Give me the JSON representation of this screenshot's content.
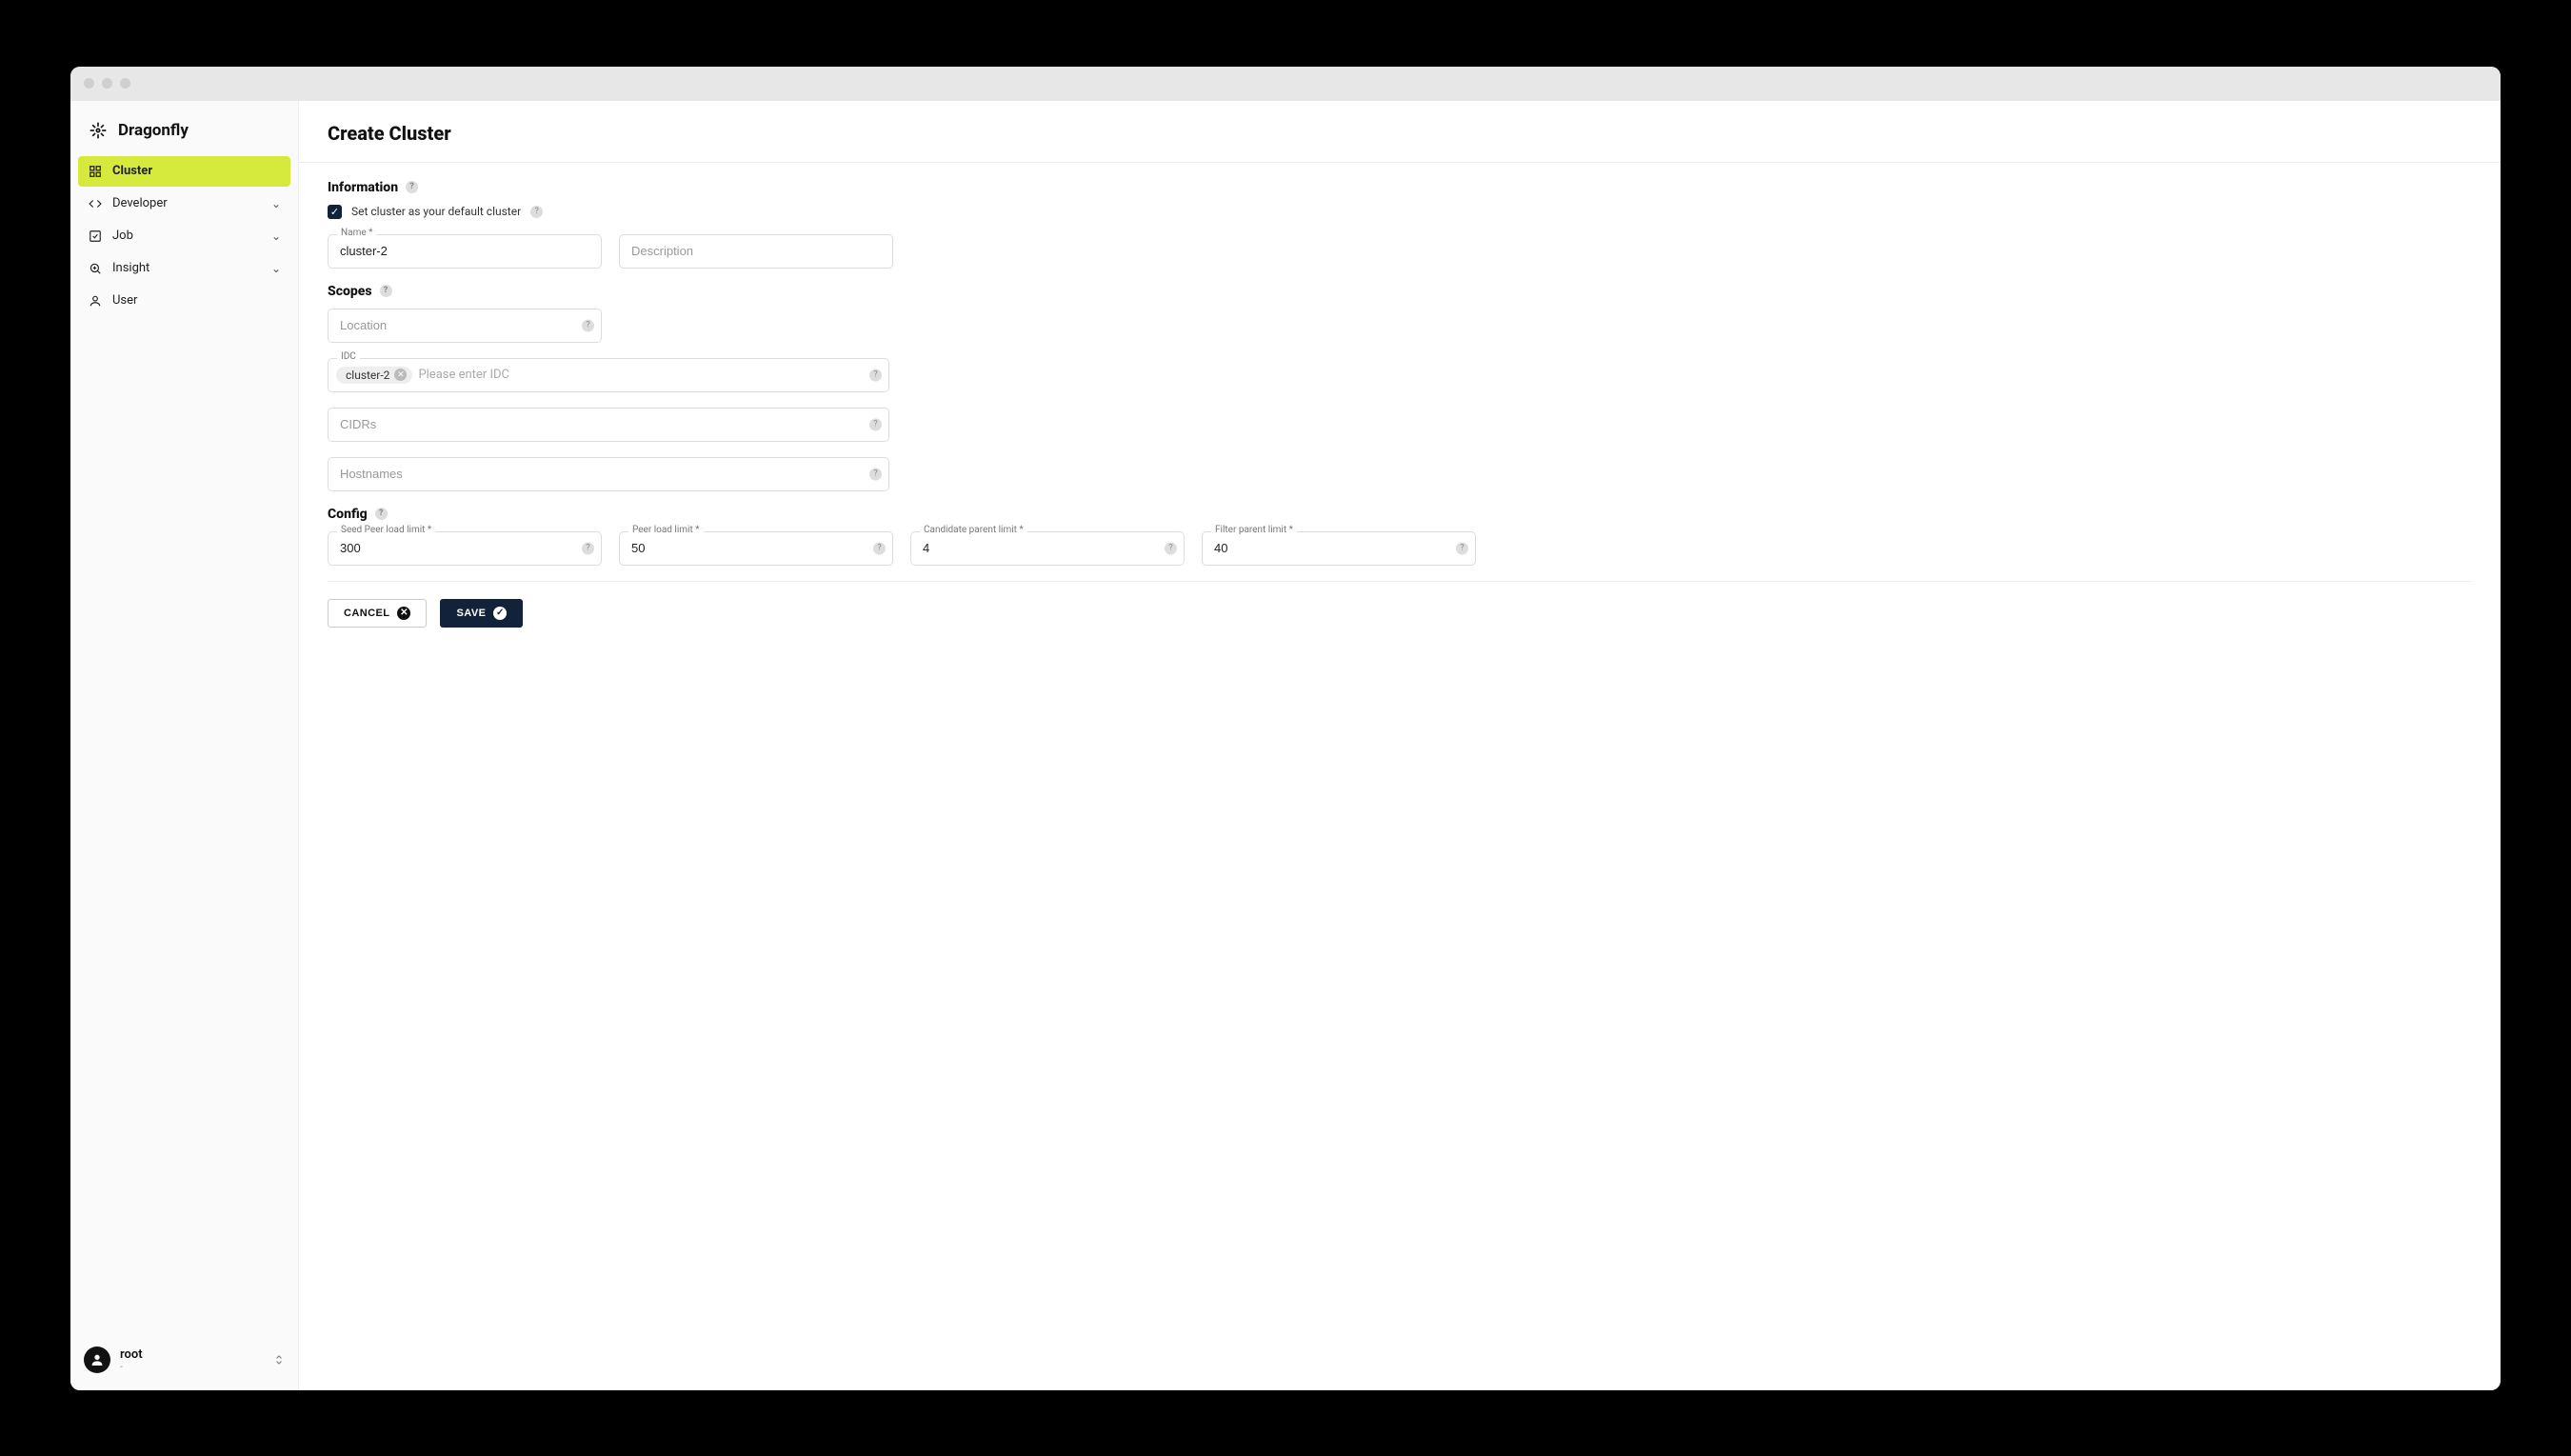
{
  "brand": {
    "name": "Dragonfly"
  },
  "sidebar": {
    "items": [
      {
        "label": "Cluster",
        "icon": "cluster-icon",
        "active": true,
        "expandable": false
      },
      {
        "label": "Developer",
        "icon": "code-icon",
        "active": false,
        "expandable": true
      },
      {
        "label": "Job",
        "icon": "check-square-icon",
        "active": false,
        "expandable": true
      },
      {
        "label": "Insight",
        "icon": "insight-icon",
        "active": false,
        "expandable": true
      },
      {
        "label": "User",
        "icon": "user-icon",
        "active": false,
        "expandable": false
      }
    ],
    "user": {
      "name": "root",
      "subtitle": "-"
    }
  },
  "page": {
    "title": "Create Cluster"
  },
  "sections": {
    "information": {
      "title": "Information",
      "default_checkbox_label": "Set cluster as your default cluster",
      "default_checked": true,
      "name_label": "Name *",
      "name_value": "cluster-2",
      "description_placeholder": "Description"
    },
    "scopes": {
      "title": "Scopes",
      "location_placeholder": "Location",
      "idc_label": "IDC",
      "idc_chips": [
        "cluster-2"
      ],
      "idc_placeholder": "Please enter IDC",
      "cidrs_placeholder": "CIDRs",
      "hostnames_placeholder": "Hostnames"
    },
    "config": {
      "title": "Config",
      "seed_peer_label": "Seed Peer load limit *",
      "seed_peer_value": "300",
      "peer_load_label": "Peer load limit *",
      "peer_load_value": "50",
      "candidate_parent_label": "Candidate parent limit *",
      "candidate_parent_value": "4",
      "filter_parent_label": "Filter parent limit *",
      "filter_parent_value": "40"
    }
  },
  "actions": {
    "cancel": "CANCEL",
    "save": "SAVE"
  }
}
